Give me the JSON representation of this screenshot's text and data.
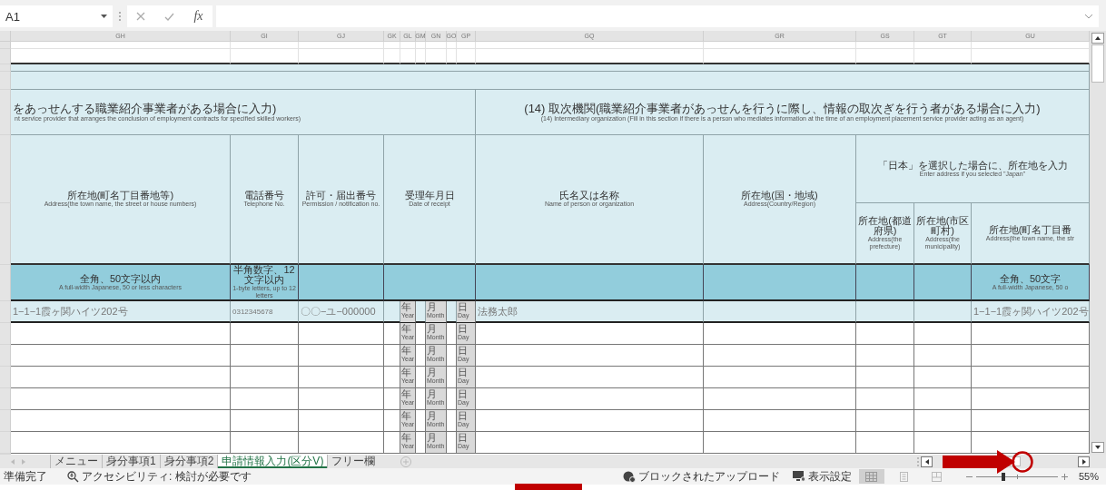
{
  "formula_bar": {
    "name_box": "A1",
    "function_label": "fx"
  },
  "column_headers": [
    "GH",
    "GI",
    "GJ",
    "GK",
    "GL",
    "GM",
    "GN",
    "GO",
    "GP",
    "GQ",
    "GR",
    "GS",
    "GT",
    "GU"
  ],
  "section_headers": [
    {
      "ja": "をあっせんする職業紹介事業者がある場合に入力)",
      "en": "nt service provider that arranges the conclusion of employment contracts for specified skilled workers)"
    },
    {
      "ja": "(14) 取次機関(職業紹介事業者があっせんを行うに際し、情報の取次ぎを行う者がある場合に入力)",
      "en": "(14) Intermediary organization (Fill in this section if there is a person who mediates information at the time of an employment placement service provider acting as an agent)"
    }
  ],
  "field_headers": [
    {
      "ja": "所在地(町名丁目番地等)",
      "en": "Address(the town name, the street or house numbers)"
    },
    {
      "ja": "電話番号",
      "en": "Telephone No."
    },
    {
      "ja": "許可・届出番号",
      "en": "Permission / notification no."
    },
    {
      "ja": "受理年月日",
      "en": "Date of receipt"
    },
    {
      "ja": "氏名又は名称",
      "en": "Name of person or organization"
    },
    {
      "ja": "所在地(国・地域)",
      "en": "Address(Country/Region)"
    }
  ],
  "address_group": {
    "ja": "「日本」を選択した場合に、所在地を入力",
    "en": "Enter address if you selected \"Japan\"",
    "subfields": [
      {
        "ja": "所在地(都道府県)",
        "en": "Address(the prefecture)"
      },
      {
        "ja": "所在地(市区町村)",
        "en": "Address(the municipality)"
      },
      {
        "ja": "所在地(町名丁目番",
        "en": "Address(the town name, the str"
      }
    ]
  },
  "format_hints": [
    {
      "ja": "全角、50文字以内",
      "en": "A full-width Japanese, 50 or less characters"
    },
    {
      "ja": "半角数字、12文字以内",
      "en": "1-byte letters, up to 12 letters"
    },
    {
      "ja": "全角、50文字",
      "en": "A full-width Japanese, 50 o"
    }
  ],
  "rows": [
    {
      "address": "1−1−1霞ヶ関ハイツ202号",
      "telephone": "0312345678",
      "permission_no": "〇〇−ユ−000000",
      "dates": [
        {
          "ja": "年",
          "en": "Year"
        },
        {
          "ja": "月",
          "en": "Month"
        },
        {
          "ja": "日",
          "en": "Day"
        }
      ],
      "name": "法務太郎",
      "town": "1−1−1霞ヶ関ハイツ202号"
    },
    {
      "dates": [
        {
          "ja": "年",
          "en": "Year"
        },
        {
          "ja": "月",
          "en": "Month"
        },
        {
          "ja": "日",
          "en": "Day"
        }
      ]
    },
    {
      "dates": [
        {
          "ja": "年",
          "en": "Year"
        },
        {
          "ja": "月",
          "en": "Month"
        },
        {
          "ja": "日",
          "en": "Day"
        }
      ]
    },
    {
      "dates": [
        {
          "ja": "年",
          "en": "Year"
        },
        {
          "ja": "月",
          "en": "Month"
        },
        {
          "ja": "日",
          "en": "Day"
        }
      ]
    },
    {
      "dates": [
        {
          "ja": "年",
          "en": "Year"
        },
        {
          "ja": "月",
          "en": "Month"
        },
        {
          "ja": "日",
          "en": "Day"
        }
      ]
    },
    {
      "dates": [
        {
          "ja": "年",
          "en": "Year"
        },
        {
          "ja": "月",
          "en": "Month"
        },
        {
          "ja": "日",
          "en": "Day"
        }
      ]
    },
    {
      "dates": [
        {
          "ja": "年",
          "en": "Year"
        },
        {
          "ja": "月",
          "en": "Month"
        },
        {
          "ja": "日",
          "en": "Day"
        }
      ]
    }
  ],
  "sheet_tabs": [
    {
      "label": "メニュー",
      "selected": false
    },
    {
      "label": "身分事項1",
      "selected": false
    },
    {
      "label": "身分事項2",
      "selected": false
    },
    {
      "label": "申請情報入力(区分V)",
      "selected": true
    },
    {
      "label": "フリー欄",
      "selected": false
    }
  ],
  "status_bar": {
    "mode": "準備完了",
    "accessibility": "アクセシビリティ: 検討が必要です",
    "blocked_uploads": "ブロックされたアップロード",
    "display_settings": "表示設定",
    "view_buttons": [
      {
        "kind": "normal",
        "selected": true
      },
      {
        "kind": "page_layout",
        "selected": false
      },
      {
        "kind": "page_break",
        "selected": false
      }
    ],
    "zoom": {
      "level": 0.33,
      "reading": "55%"
    }
  }
}
